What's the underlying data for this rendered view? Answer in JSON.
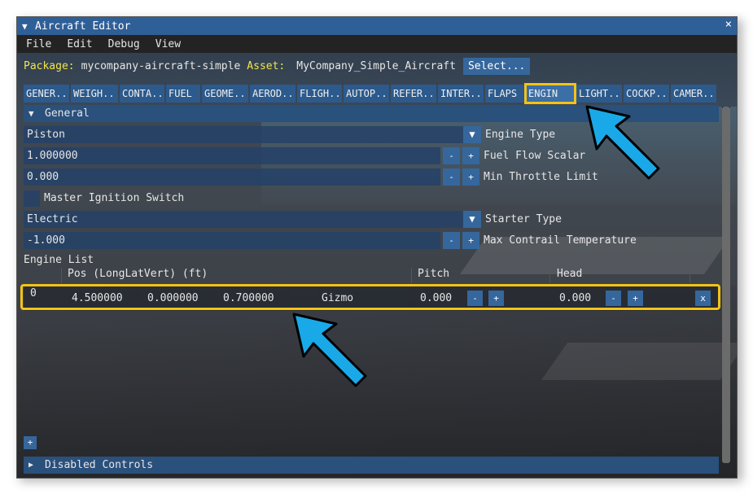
{
  "window": {
    "title": "Aircraft Editor",
    "close_label": "×"
  },
  "menu": [
    "File",
    "Edit",
    "Debug",
    "View"
  ],
  "package": {
    "package_label": "Package:",
    "package_value": "mycompany-aircraft-simple",
    "asset_label": "Asset:",
    "asset_value": "MyCompany_Simple_Aircraft",
    "select_label": "Select..."
  },
  "tabs": [
    "GENER..",
    "WEIGH..",
    "CONTA..",
    "FUEL",
    "GEOME..",
    "AEROD..",
    "FLIGH..",
    "AUTOP..",
    "REFER..",
    "INTER..",
    "FLAPS",
    "ENGIN",
    "LIGHT..",
    "COCKP..",
    "CAMER.."
  ],
  "active_tab": "ENGIN",
  "sections": {
    "general": "General",
    "disabled": "Disabled Controls"
  },
  "rows": {
    "engine_type": {
      "value": "Piston",
      "label": "Engine Type"
    },
    "fuel_flow": {
      "value": "1.000000",
      "label": "Fuel Flow Scalar"
    },
    "min_throttle": {
      "value": "0.000",
      "label": "Min Throttle Limit"
    },
    "master_ignition": {
      "label": "Master Ignition Switch"
    },
    "starter_type": {
      "value": "Electric",
      "label": "Starter Type"
    },
    "contrail": {
      "value": "-1.000",
      "label": "Max Contrail Temperature"
    }
  },
  "engine_list": {
    "title": "Engine List",
    "headers": {
      "pos": "Pos (LongLatVert) (ft)",
      "pitch": "Pitch",
      "head": "Head"
    },
    "row": {
      "index": "0",
      "long": "4.500000",
      "lat": "0.000000",
      "vert": "0.700000",
      "gizmo": "Gizmo",
      "pitch": "0.000",
      "head": "0.000",
      "remove": "x"
    }
  },
  "glyphs": {
    "minus": "-",
    "plus": "+",
    "dropdown": "▼",
    "expand": "▼",
    "collapsed": "▶"
  },
  "colors": {
    "title_bar": "#2f5f97",
    "button": "#35679c",
    "highlight": "#f2c318",
    "arrow": "#19a9e8",
    "accent_text": "#f2e54a"
  }
}
